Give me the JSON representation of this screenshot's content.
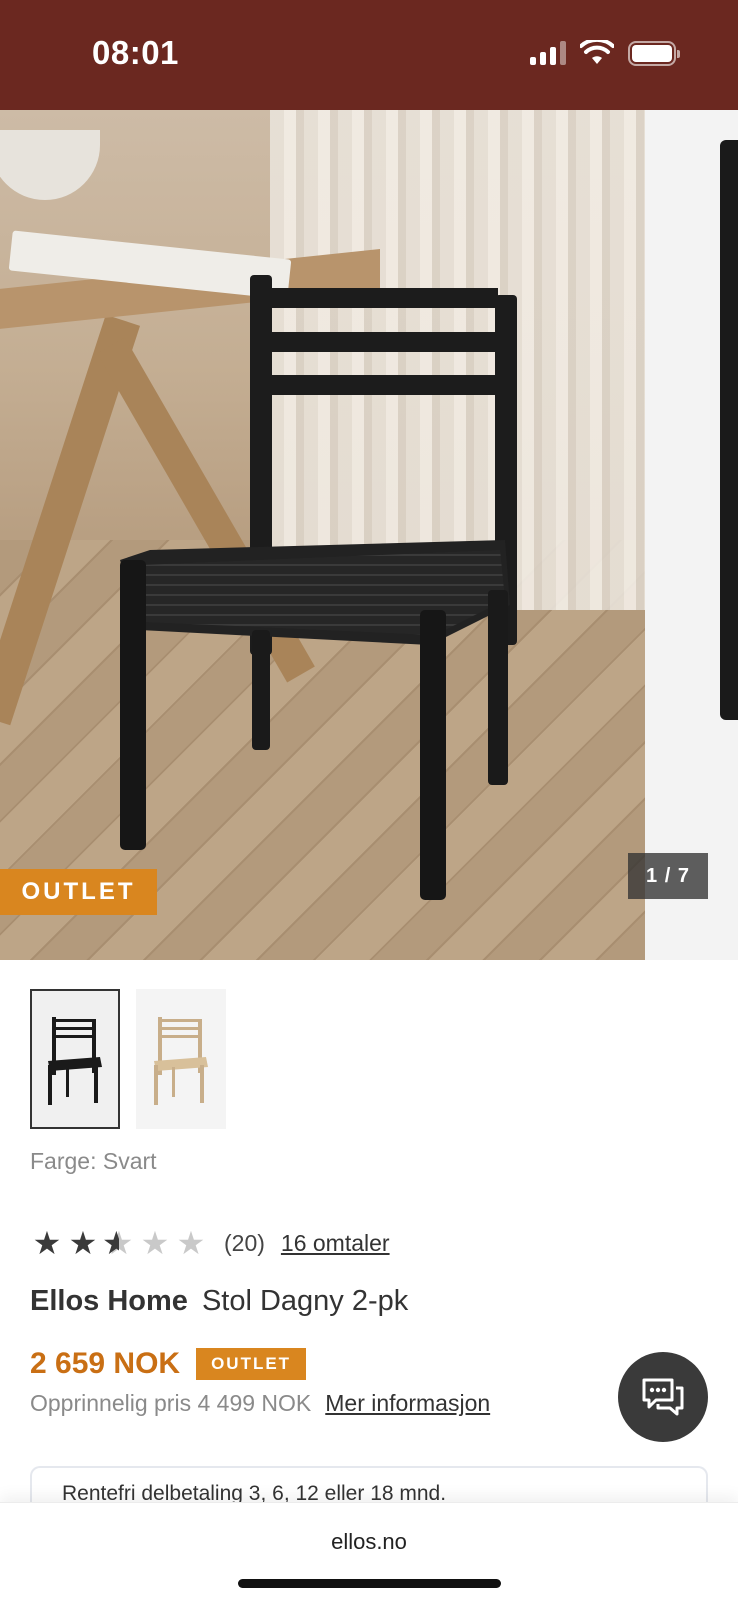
{
  "status_bar": {
    "time": "08:01",
    "background": "#6b2820",
    "icons": [
      "signal-icon",
      "wifi-icon",
      "battery-icon"
    ]
  },
  "gallery": {
    "badge": "OUTLET",
    "counter": "1 / 7",
    "current_image": 1,
    "total_images": 7
  },
  "thumbnails": [
    {
      "color": "black",
      "selected": true
    },
    {
      "color": "natural",
      "selected": false
    }
  ],
  "color_label": "Farge: Svart",
  "rating": {
    "stars": 2.5,
    "max": 5,
    "count": "(20)",
    "reviews_link": "16 omtaler"
  },
  "product": {
    "brand": "Ellos Home",
    "name": "Stol Dagny 2-pk",
    "price": "2 659 NOK",
    "badge": "OUTLET",
    "original_price": "Opprinnelig pris 4 499 NOK",
    "more_info": "Mer informasjon"
  },
  "finance": {
    "text": "Rentefri delbetaling 3, 6, 12 eller 18 mnd."
  },
  "browser": {
    "url": "ellos.no"
  },
  "colors": {
    "accent_orange": "#d9861f",
    "price_orange": "#c96f14",
    "header_brown": "#6b2820"
  }
}
